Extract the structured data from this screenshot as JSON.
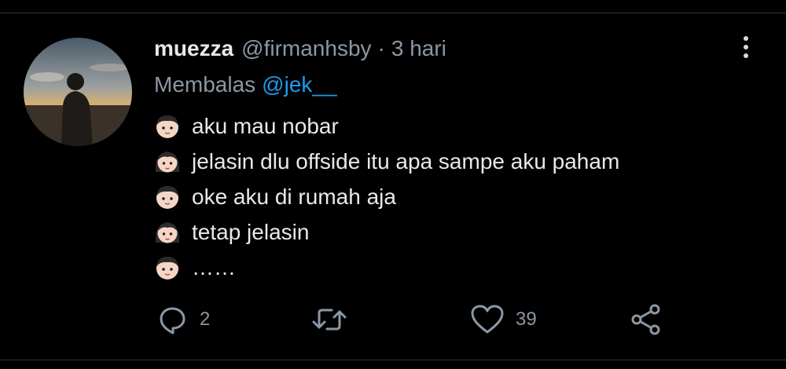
{
  "tweet": {
    "display_name": "muezza",
    "handle": "@firmanhsby",
    "separator": "·",
    "time": "3 hari",
    "reply_label": "Membalas",
    "reply_to": "@jek__",
    "lines": [
      "aku mau nobar",
      "jelasin dlu offside itu apa sampe aku paham",
      "oke aku di rumah aja",
      "tetap jelasin",
      "……"
    ],
    "line_emoji": [
      "boy-face-icon",
      "girl-face-icon",
      "boy-face-icon",
      "girl-face-icon",
      "boy-face-icon"
    ]
  },
  "actions": {
    "reply_count": "2",
    "retweet_count": "",
    "like_count": "39"
  },
  "colors": {
    "background": "#000000",
    "text": "#e7e9ea",
    "muted": "#8b98a5",
    "link": "#1d9bf0",
    "divider": "#2f3336"
  }
}
